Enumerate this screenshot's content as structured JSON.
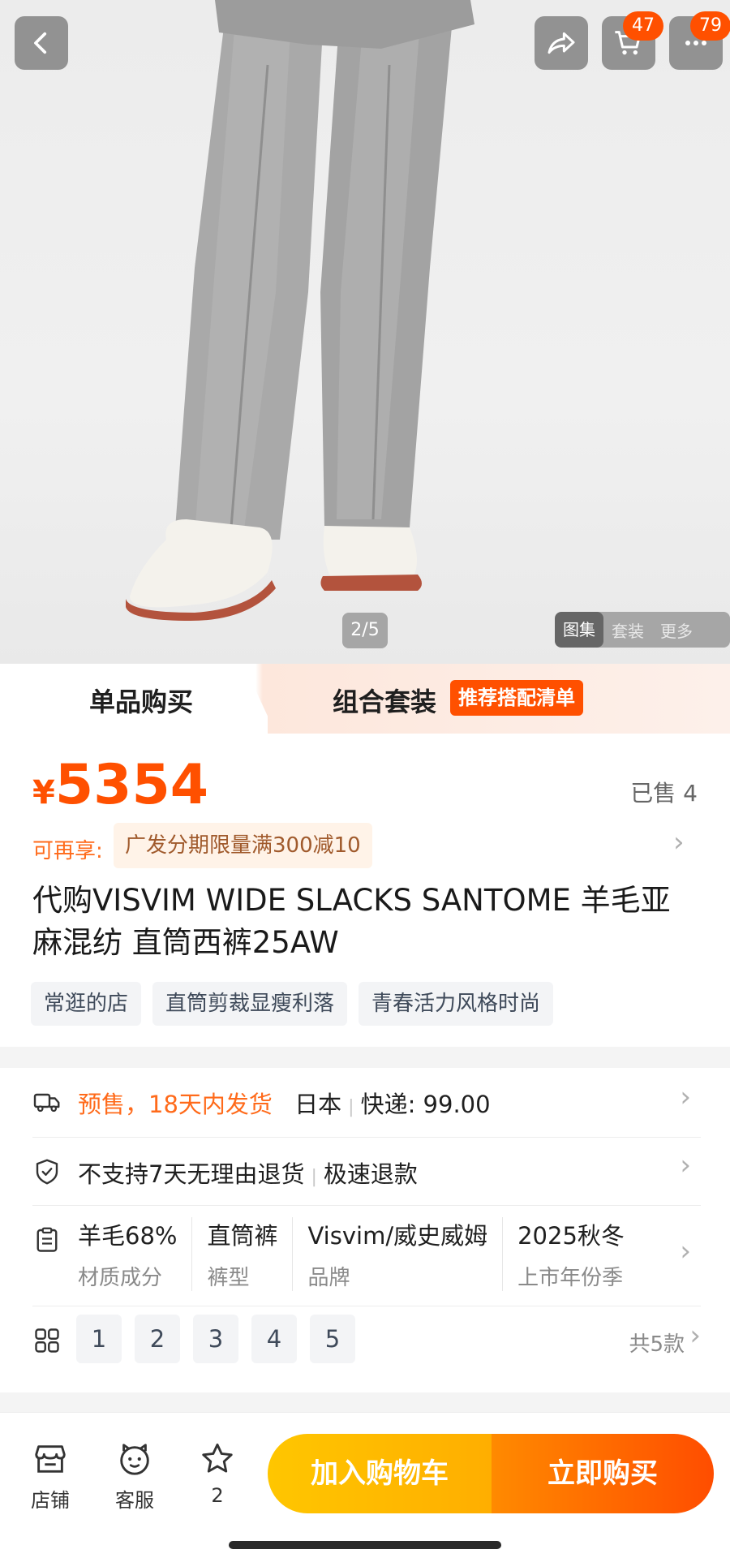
{
  "header": {
    "cart_badge": "47",
    "more_badge": "79"
  },
  "gallery": {
    "pager": "2/5",
    "tabs": [
      "图集",
      "套装",
      "更多"
    ]
  },
  "purchase_modes": {
    "single": "单品购买",
    "combo": "组合套装",
    "combo_tag": "推荐搭配清单"
  },
  "price": {
    "currency": "¥",
    "value": "5354",
    "sold": "已售 4"
  },
  "promo": {
    "label": "可再享:",
    "text": "广发分期限量满300减10"
  },
  "product": {
    "title": "代购VISVIM WIDE SLACKS SANTOME 羊毛亚麻混纺 直筒西裤25AW",
    "tags": [
      "常逛的店",
      "直筒剪裁显瘦利落",
      "青春活力风格时尚"
    ]
  },
  "shipping": {
    "presale": "预售，18天内发货",
    "origin": "日本",
    "express": "快递: 99.00"
  },
  "returns": {
    "policy": "不支持7天无理由退货",
    "refund": "极速退款"
  },
  "attributes": [
    {
      "value": "羊毛68%",
      "key": "材质成分"
    },
    {
      "value": "直筒裤",
      "key": "裤型"
    },
    {
      "value": "Visvim/威史威姆",
      "key": "品牌"
    },
    {
      "value": "2025秋冬",
      "key": "上市年份季"
    }
  ],
  "skus": {
    "items": [
      "1",
      "2",
      "3",
      "4",
      "5"
    ],
    "total": "共5款"
  },
  "bottom_nav": {
    "store": "店铺",
    "service": "客服",
    "favorite_count": "2",
    "add_to_cart": "加入购物车",
    "buy_now": "立即购买"
  },
  "colors": {
    "accent": "#ff5000",
    "cart_button": "#ffb800",
    "buy_button": "#ff5a00"
  },
  "icons": [
    "back-icon",
    "share-icon",
    "cart-icon",
    "more-icon",
    "truck-icon",
    "shield-icon",
    "clipboard-icon",
    "grid-icon",
    "store-icon",
    "service-icon",
    "star-icon"
  ]
}
